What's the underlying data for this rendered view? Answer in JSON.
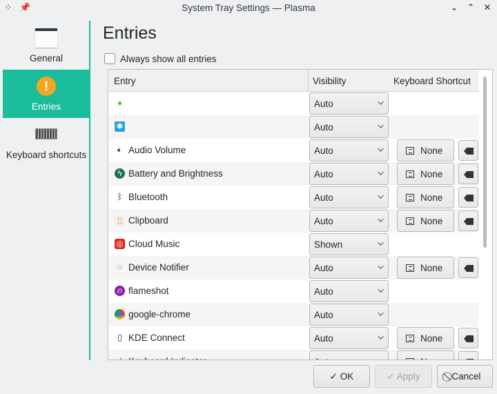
{
  "window": {
    "title": "System Tray Settings — Plasma"
  },
  "sidebar": {
    "items": [
      {
        "label": "General",
        "icon": "window-icon",
        "selected": false
      },
      {
        "label": "Entries",
        "icon": "warning-icon",
        "selected": true
      },
      {
        "label": "Keyboard shortcuts",
        "icon": "keyboard-icon",
        "selected": false
      }
    ]
  },
  "colors": {
    "accent": "#1abc9c",
    "warning": "#f5a623"
  },
  "main": {
    "title": "Entries",
    "always_show_label": "Always show all entries",
    "always_show_checked": false,
    "columns": [
      "Entry",
      "Visibility",
      "Keyboard Shortcut"
    ],
    "entries": [
      {
        "name": "",
        "icon": "wechat-icon",
        "visibility": "Auto",
        "shortcut": null
      },
      {
        "name": "",
        "icon": "app-status-icon",
        "visibility": "Auto",
        "shortcut": null
      },
      {
        "name": "Audio Volume",
        "icon": "speaker-icon",
        "visibility": "Auto",
        "shortcut": "None"
      },
      {
        "name": "Battery and Brightness",
        "icon": "battery-icon",
        "visibility": "Auto",
        "shortcut": "None"
      },
      {
        "name": "Bluetooth",
        "icon": "bluetooth-icon",
        "visibility": "Auto",
        "shortcut": "None"
      },
      {
        "name": "Clipboard",
        "icon": "clipboard-icon",
        "visibility": "Auto",
        "shortcut": "None"
      },
      {
        "name": "Cloud Music",
        "icon": "cloud-music-icon",
        "visibility": "Shown",
        "shortcut": null
      },
      {
        "name": "Device Notifier",
        "icon": "device-notifier-icon",
        "visibility": "Auto",
        "shortcut": "None"
      },
      {
        "name": "flameshot",
        "icon": "flameshot-icon",
        "visibility": "Auto",
        "shortcut": null
      },
      {
        "name": "google-chrome",
        "icon": "chrome-icon",
        "visibility": "Auto",
        "shortcut": null
      },
      {
        "name": "KDE Connect",
        "icon": "phone-icon",
        "visibility": "Auto",
        "shortcut": "None"
      },
      {
        "name": "Keyboard Indicator",
        "icon": "keyboard-indicator-icon",
        "visibility": "Auto",
        "shortcut": "None"
      }
    ]
  },
  "buttons": {
    "ok": "✓ OK",
    "apply": "✓ Apply",
    "cancel": "⃠ Cancel"
  }
}
